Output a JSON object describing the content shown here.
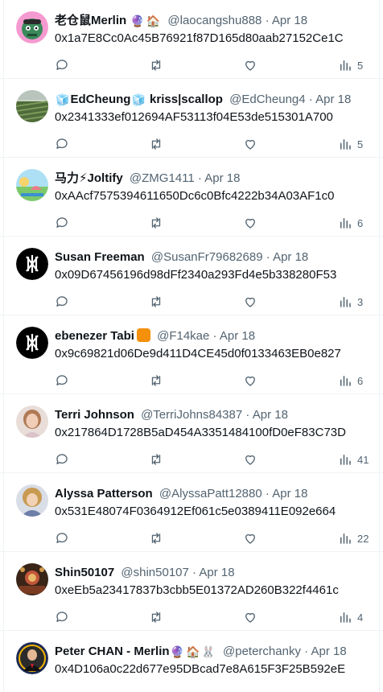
{
  "tweets": [
    {
      "name": "老仓鼠Merlin",
      "emojis": [
        "🔮",
        "🏠"
      ],
      "handle": "@laocangshu888",
      "date": "Apr 18",
      "text": "0x1a7E8Cc0Ac45B76921f87D165d80aab27152Ce1C",
      "views": "5",
      "avatar_icon": "zombie-avatar-icon"
    },
    {
      "name_prefix_emoji": "🧊",
      "name": "EdCheung",
      "name_suffix_emoji": "🧊",
      "name_extra": "kriss|scallop",
      "handle": "@EdCheung4",
      "date": "Apr 18",
      "text": "0x2341333ef012694AF53113f04E53de515301A700",
      "views": "5",
      "avatar_icon": "field-photo-avatar-icon"
    },
    {
      "name": "马力⚡Joltify",
      "handle": "@ZMG1411",
      "date": "Apr 18",
      "text": "0xAAcf7575394611650Dc6c0Bfc4222b34A03AF1c0",
      "views": "6",
      "avatar_icon": "cartoon-landscape-avatar-icon"
    },
    {
      "name": "Susan Freeman",
      "handle": "@SusanFr79682689",
      "date": "Apr 18",
      "text": "0x09D67456196d98dFf2340a293Fd4e5b338280F53",
      "views": "3",
      "avatar_icon": "black-logo-avatar-icon"
    },
    {
      "name": "ebenezer Tabi",
      "badge_color": "#f4900c",
      "handle": "@F14kae",
      "date": "Apr 18",
      "text": "0x9c69821d06De9d411D4CE45d0f0133463EB0e827",
      "views": "6",
      "avatar_icon": "black-logo-avatar-icon"
    },
    {
      "name": "Terri Johnson",
      "handle": "@TerriJohns84387",
      "date": "Apr 18",
      "text": "0x217864D1728B5aD454A3351484100fD0eF83C73D",
      "views": "41",
      "avatar_icon": "portrait-avatar-icon"
    },
    {
      "name": "Alyssa Patterson",
      "handle": "@AlyssaPatt12880",
      "date": "Apr 18",
      "text": "0x531E48074F0364912Ef061c5e0389411E092e664",
      "views": "22",
      "avatar_icon": "curly-portrait-avatar-icon"
    },
    {
      "name": "Shin50107",
      "handle": "@shin50107",
      "date": "Apr 18",
      "text": "0xeEb5a23417837b3cbb5E01372AD260B322f4461c",
      "views": "4",
      "avatar_icon": "ornate-avatar-icon"
    },
    {
      "name": "Peter CHAN - Merlin",
      "emojis": [
        "🔮",
        "🏠",
        "🐰"
      ],
      "handle": "@peterchanky",
      "date": "Apr 18",
      "text": "0x4D106a0c22d677e95DBcad7e8A615F3F25B592eE",
      "views": "",
      "avatar_icon": "suit-portrait-avatar-icon"
    }
  ],
  "separator": "·",
  "colors": {
    "text": "#0f1419",
    "muted": "#536471",
    "border": "#eff3f4"
  }
}
